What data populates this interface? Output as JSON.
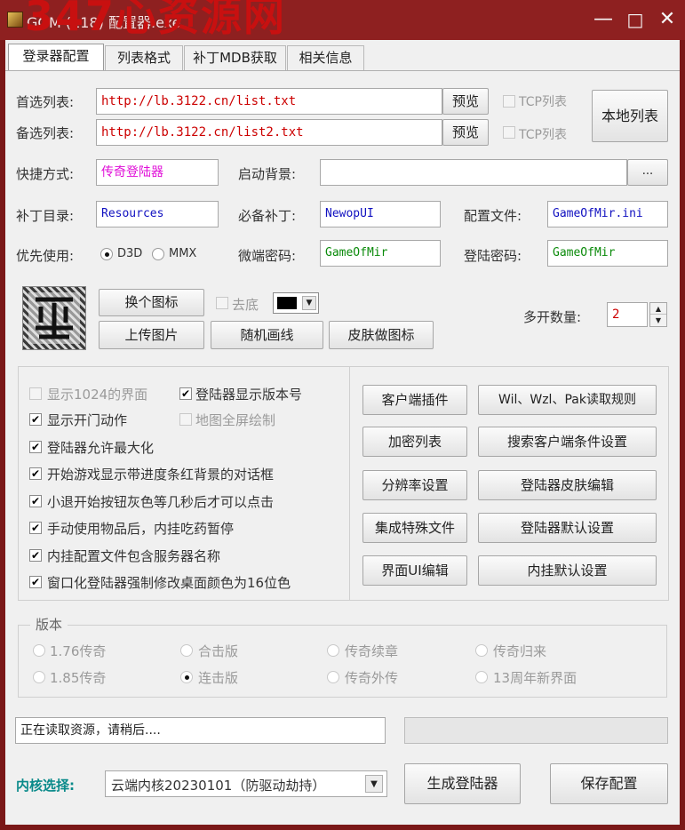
{
  "window": {
    "watermark": "347心资源网",
    "title": "GOM (118) 配置器.exe",
    "minimize": "—",
    "maximize": "□",
    "close": "✕"
  },
  "tabs": [
    "登录器配置",
    "列表格式",
    "补丁MDB获取",
    "相关信息"
  ],
  "server_list": {
    "primary_label": "首选列表:",
    "primary_url": "http://lb.3122.cn/list.txt",
    "backup_label": "备选列表:",
    "backup_url": "http://lb.3122.cn/list2.txt",
    "preview": "预览",
    "tcp": "TCP列表",
    "local_list": "本地列表"
  },
  "shortcut": {
    "label": "快捷方式:",
    "value": "传奇登陆器"
  },
  "startup_bg": {
    "label": "启动背景:",
    "value": "",
    "browse": "..."
  },
  "patch_dir": {
    "label": "补丁目录:",
    "value": "Resources"
  },
  "required_patch": {
    "label": "必备补丁:",
    "value": "NewopUI"
  },
  "config_file": {
    "label": "配置文件:",
    "value": "GameOfMir.ini"
  },
  "priority": {
    "label": "优先使用:",
    "d3d": "D3D",
    "mmx": "MMX"
  },
  "micro_pwd": {
    "label": "微端密码:",
    "value": "GameOfMir"
  },
  "login_pwd": {
    "label": "登陆密码:",
    "value": "GameOfMir"
  },
  "icon_buttons": {
    "change_icon": "换个图标",
    "upload_image": "上传图片",
    "remove_bg": "去底",
    "random_lines": "随机画线",
    "skin_icon": "皮肤做图标"
  },
  "multi_open": {
    "label": "多开数量:",
    "value": "2"
  },
  "options": [
    {
      "text": "显示1024的界面",
      "checked": false,
      "disabled": true
    },
    {
      "text": "登陆器显示版本号",
      "checked": true,
      "disabled": false
    },
    {
      "text": "显示开门动作",
      "checked": true,
      "disabled": false
    },
    {
      "text": "地图全屏绘制",
      "checked": false,
      "disabled": true
    },
    {
      "text": "登陆器允许最大化",
      "checked": true,
      "disabled": false
    },
    {
      "text": "开始游戏显示带进度条红背景的对话框",
      "checked": true,
      "disabled": false
    },
    {
      "text": "小退开始按钮灰色等几秒后才可以点击",
      "checked": true,
      "disabled": false
    },
    {
      "text": "手动使用物品后，内挂吃药暂停",
      "checked": true,
      "disabled": false
    },
    {
      "text": "内挂配置文件包含服务器名称",
      "checked": true,
      "disabled": false
    },
    {
      "text": "窗口化登陆器强制修改桌面颜色为16位色",
      "checked": true,
      "disabled": false
    }
  ],
  "right_buttons": [
    [
      "客户端插件",
      "Wil、Wzl、Pak读取规则"
    ],
    [
      "加密列表",
      "搜索客户端条件设置"
    ],
    [
      "分辨率设置",
      "登陆器皮肤编辑"
    ],
    [
      "集成特殊文件",
      "登陆器默认设置"
    ],
    [
      "界面UI编辑",
      "内挂默认设置"
    ]
  ],
  "version": {
    "label": "版本",
    "options": [
      [
        "1.76传奇",
        "合击版",
        "传奇续章",
        "传奇归来"
      ],
      [
        "1.85传奇",
        "连击版",
        "传奇外传",
        "13周年新界面"
      ]
    ],
    "selected": "连击版"
  },
  "status": {
    "text": "正在读取资源，请稍后...."
  },
  "bottom": {
    "core_label": "内核选择:",
    "core_value": "云端内核20230101（防驱动劫持）",
    "generate": "生成登陆器",
    "save": "保存配置"
  },
  "colors": {
    "title_bar": "#8e2020",
    "url_text": "#cc0000",
    "pink_text": "#e00fd8",
    "blue_text": "#1010c0",
    "green_text": "#0a8a0a",
    "core_label": "#0a8a8a"
  }
}
